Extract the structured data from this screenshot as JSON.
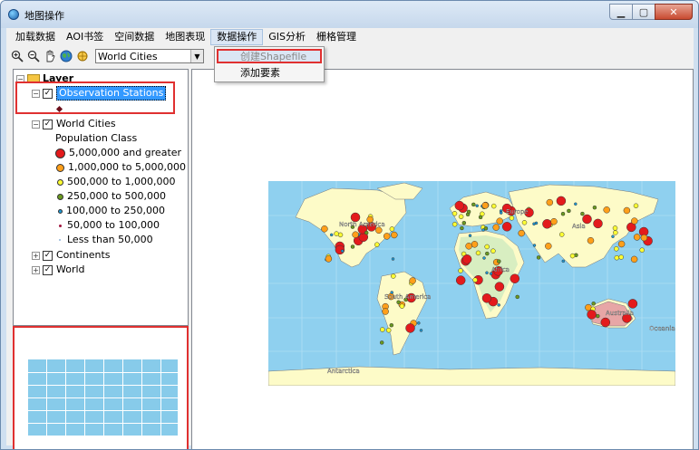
{
  "window": {
    "title": "地图操作"
  },
  "menu": {
    "items": [
      "加载数据",
      "AOI书签",
      "空间数据",
      "地图表现",
      "数据操作",
      "GIS分析",
      "栅格管理"
    ],
    "active_index": 4
  },
  "dropdown": {
    "items": [
      {
        "label": "创建Shapefile",
        "disabled": true
      },
      {
        "label": "添加要素",
        "disabled": false
      }
    ]
  },
  "toolbar": {
    "icons": [
      "zoom-in-icon",
      "zoom-out-icon",
      "pan-icon",
      "full-extent-icon"
    ],
    "layer_select_value": "World Cities"
  },
  "toc": {
    "root": "Layer",
    "layers": [
      {
        "name": "Observation Stations",
        "checked": true,
        "expanded": true,
        "selected": true
      },
      {
        "name": "World Cities",
        "checked": true,
        "expanded": true
      },
      {
        "name": "Continents",
        "checked": true,
        "expanded": false
      },
      {
        "name": "World",
        "checked": true,
        "expanded": false
      }
    ],
    "legend_title": "Population Class",
    "legend": [
      {
        "label": "5,000,000 and greater",
        "color": "#e31a1c"
      },
      {
        "label": "1,000,000 to 5,000,000",
        "color": "#ff9f1a"
      },
      {
        "label": "500,000 to 1,000,000",
        "color": "#ffff33"
      },
      {
        "label": "250,000 to 500,000",
        "color": "#6a9a1f"
      },
      {
        "label": "100,000 to 250,000",
        "color": "#1f9ad6"
      },
      {
        "label": "50,000 to 100,000",
        "color": "#a0143c"
      },
      {
        "label": "Less than 50,000",
        "color": "#8fb4d8"
      }
    ]
  },
  "map": {
    "labels": [
      "North America",
      "Europe",
      "Asia",
      "Africa",
      "South America",
      "Australia",
      "Oceania",
      "Antarctica"
    ],
    "ocean_color": "#8fd0ef",
    "land_color": "#fdfbc8"
  }
}
